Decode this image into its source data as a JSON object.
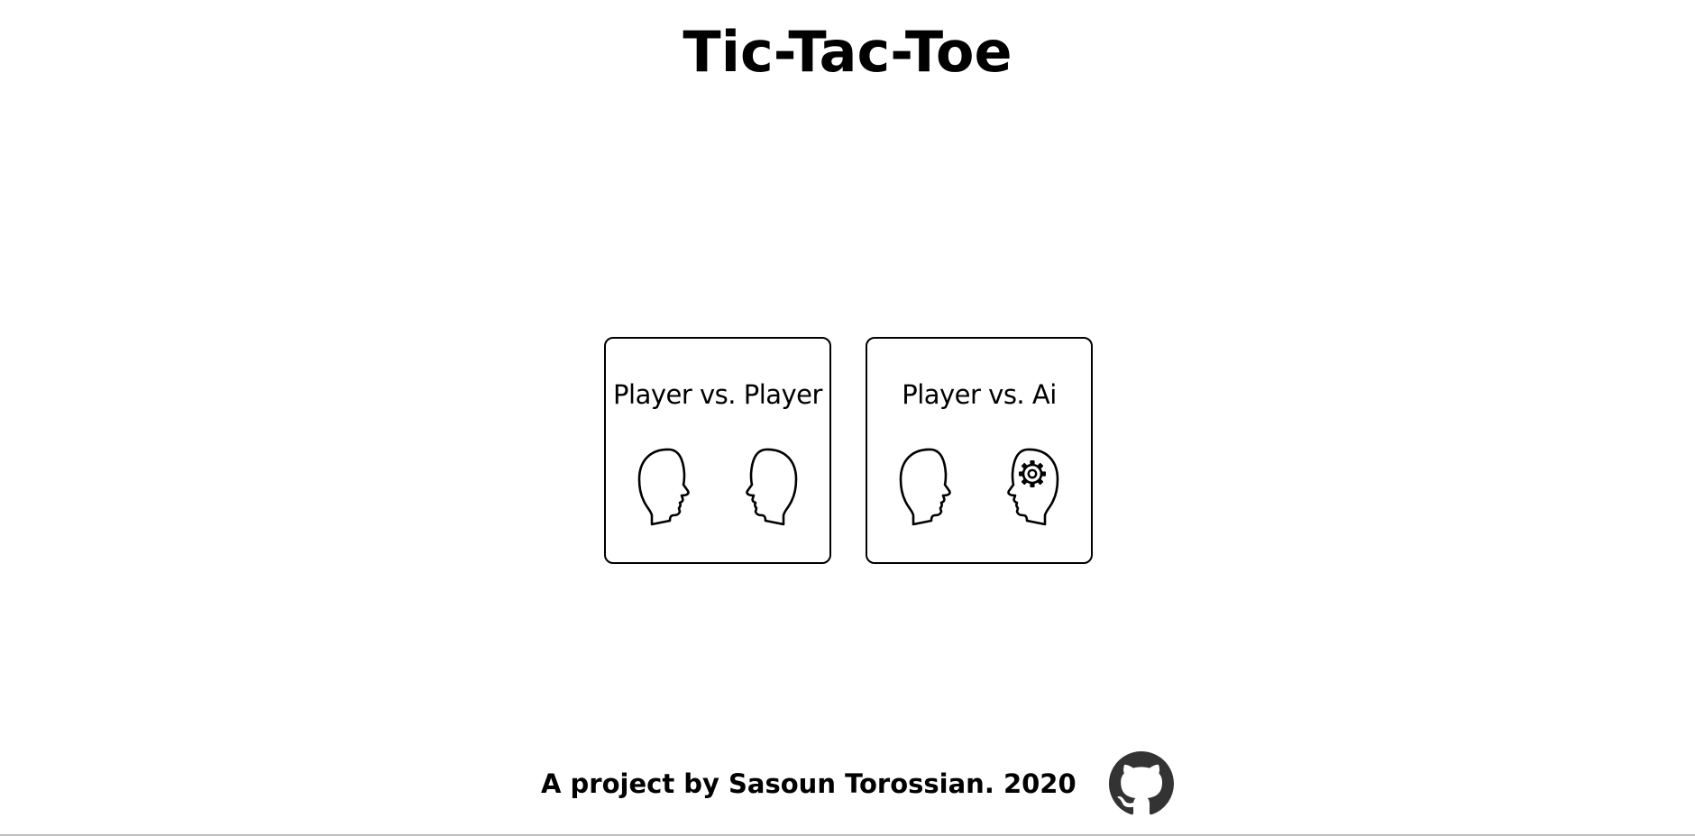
{
  "page": {
    "title": "Tic-Tac-Toe"
  },
  "modes": [
    {
      "label": "Player vs. Player",
      "icons": [
        "head-profile-right-icon",
        "head-profile-left-icon"
      ]
    },
    {
      "label": "Player vs. Ai",
      "icons": [
        "head-profile-right-icon",
        "ai-head-gear-icon"
      ]
    }
  ],
  "footer": {
    "credit": "A project by Sasoun Torossian. 2020",
    "link_icon": "github-icon"
  },
  "colors": {
    "background": "#ffffff",
    "text": "#000000",
    "github": "#333333"
  }
}
